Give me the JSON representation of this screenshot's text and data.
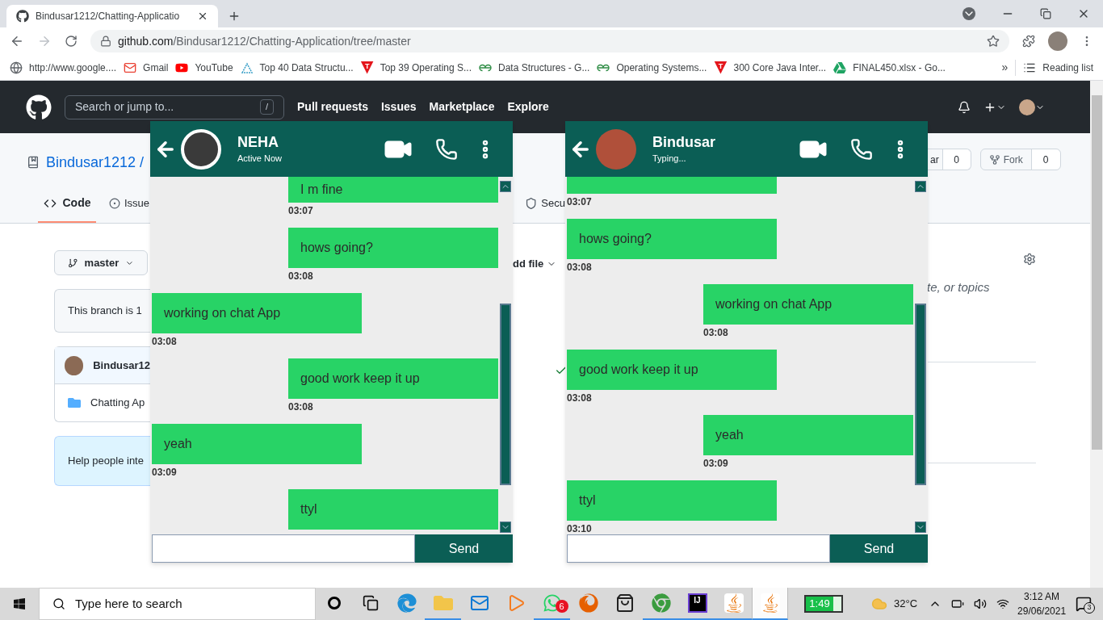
{
  "browser": {
    "tab_title": "Bindusar1212/Chatting-Applicatio",
    "url_host": "github.com",
    "url_path": "/Bindusar1212/Chatting-Application/tree/master",
    "bookmarks": [
      {
        "kind": "globe",
        "label": "http://www.google...."
      },
      {
        "kind": "gmail",
        "label": "Gmail"
      },
      {
        "kind": "youtube",
        "label": "YouTube"
      },
      {
        "kind": "graph",
        "label": "Top 40 Data Structu..."
      },
      {
        "kind": "t-logo",
        "label": "Top 39 Operating S...",
        "mark": "T"
      },
      {
        "kind": "gfg",
        "label": "Data Structures - G..."
      },
      {
        "kind": "gfg",
        "label": "Operating Systems..."
      },
      {
        "kind": "t-logo",
        "label": "300 Core Java Inter...",
        "mark": "T"
      },
      {
        "kind": "drive",
        "label": "FINAL450.xlsx - Go..."
      }
    ],
    "more": "»",
    "reading_list": "Reading list"
  },
  "github": {
    "search_placeholder": "Search or jump to...",
    "search_key": "/",
    "nav": [
      "Pull requests",
      "Issues",
      "Marketplace",
      "Explore"
    ],
    "repo_owner": "Bindusar1212 /",
    "tabs": [
      {
        "kind": "code",
        "label": "Code",
        "selected": true
      },
      {
        "kind": "issues",
        "label": "Issue",
        "selected": false
      },
      {
        "kind": "security",
        "label": "Secu",
        "selected": false
      }
    ],
    "star_label": "ar",
    "star_count": "0",
    "fork_label": "Fork",
    "fork_count": "0",
    "branch": "master",
    "add_file": "dd file",
    "branch_notice": "This branch is 1",
    "commit_author": "Bindusar12",
    "folder": "Chatting Ap",
    "help_text": "Help people inte",
    "about_text": "te, or topics"
  },
  "chats": [
    {
      "name": "NEHA",
      "status": "Active Now",
      "send": "Send",
      "messages": [
        {
          "kind": "sent",
          "text": "I m fine",
          "time": "03:07"
        },
        {
          "kind": "sent",
          "text": "hows going?",
          "time": "03:08"
        },
        {
          "kind": "received",
          "text": "working on chat App",
          "time": "03:08"
        },
        {
          "kind": "sent",
          "text": "good work keep it up",
          "time": "03:08"
        },
        {
          "kind": "received",
          "text": "yeah",
          "time": "03:09"
        },
        {
          "kind": "sent",
          "text": "ttyl"
        }
      ]
    },
    {
      "name": "Bindusar",
      "status": "Typing...",
      "send": "Send",
      "messages": [
        {
          "kind": "received",
          "time": "03:07"
        },
        {
          "kind": "received",
          "text": "hows going?",
          "time": "03:08"
        },
        {
          "kind": "sent",
          "text": "working on chat App",
          "time": "03:08"
        },
        {
          "kind": "received",
          "text": "good work keep it up",
          "time": "03:08"
        },
        {
          "kind": "sent",
          "text": "yeah",
          "time": "03:09"
        },
        {
          "kind": "received",
          "text": "ttyl",
          "time": "03:10"
        }
      ]
    }
  ],
  "taskbar": {
    "search_placeholder": "Type here to search",
    "apps": [
      {
        "kind": "cortana",
        "running": false,
        "selected": false
      },
      {
        "kind": "taskview",
        "running": false,
        "selected": false
      },
      {
        "kind": "edge",
        "running": false,
        "selected": false
      },
      {
        "kind": "explorer",
        "running": true,
        "selected": false
      },
      {
        "kind": "mail",
        "running": false,
        "selected": false
      },
      {
        "kind": "media",
        "running": false,
        "selected": false
      },
      {
        "kind": "whatsapp",
        "running": true,
        "selected": false,
        "badge": "6"
      },
      {
        "kind": "firefox",
        "running": false,
        "selected": false
      },
      {
        "kind": "store",
        "running": false,
        "selected": false
      },
      {
        "kind": "chrome",
        "running": true,
        "selected": false
      },
      {
        "kind": "intellij",
        "running": true,
        "selected": false,
        "mark": "IJ"
      },
      {
        "kind": "java",
        "running": true,
        "selected": false
      },
      {
        "kind": "java",
        "running": true,
        "selected": true
      }
    ],
    "battery_time": "1:49",
    "weather": "32°C",
    "time": "3:12 AM",
    "date": "29/06/2021",
    "notifications": "3"
  }
}
